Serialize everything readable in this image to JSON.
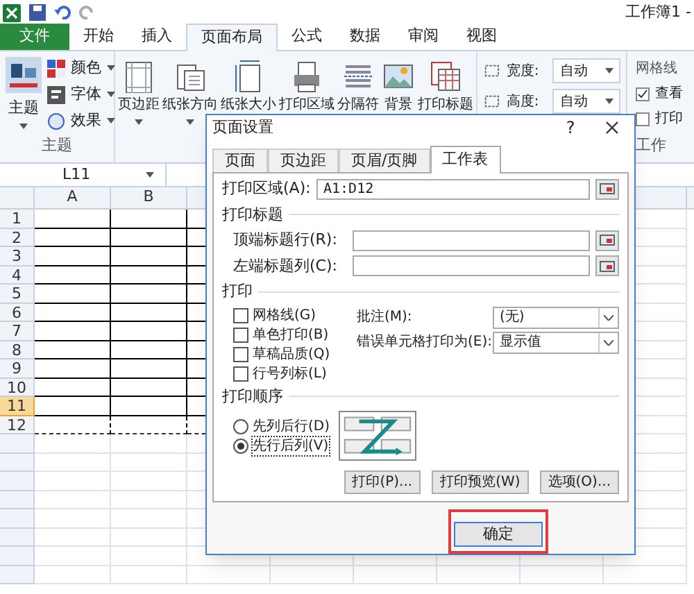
{
  "title_bar": {
    "title": "工作簿1 -"
  },
  "ribbon_tabs": [
    {
      "label": "文件",
      "kind": "file",
      "selected": false
    },
    {
      "label": "开始",
      "kind": "tab",
      "selected": false
    },
    {
      "label": "插入",
      "kind": "tab",
      "selected": false
    },
    {
      "label": "页面布局",
      "kind": "tab",
      "selected": true
    },
    {
      "label": "公式",
      "kind": "tab",
      "selected": false
    },
    {
      "label": "数据",
      "kind": "tab",
      "selected": false
    },
    {
      "label": "审阅",
      "kind": "tab",
      "selected": false
    },
    {
      "label": "视图",
      "kind": "tab",
      "selected": false
    }
  ],
  "theme_group": {
    "label": "主题",
    "main_button": "主题",
    "small_buttons": [
      "颜色",
      "字体",
      "效果"
    ]
  },
  "page_setup_buttons": [
    {
      "label": "页边距",
      "caret": true
    },
    {
      "label": "纸张方向",
      "caret": true
    },
    {
      "label": "纸张大小",
      "caret": false
    },
    {
      "label": "打印区域",
      "caret": false
    },
    {
      "label": "分隔符",
      "caret": false
    },
    {
      "label": "背景",
      "caret": false
    },
    {
      "label": "打印标题",
      "caret": false
    }
  ],
  "scale_group": [
    {
      "label": "宽度:",
      "value": "自动"
    },
    {
      "label": "高度:",
      "value": "自动"
    }
  ],
  "sheet_options": {
    "heading": "网格线",
    "items": [
      {
        "label": "查看",
        "checked": true
      },
      {
        "label": "打印",
        "checked": false
      }
    ],
    "group_label": "工作"
  },
  "name_box": "L11",
  "sheet": {
    "columns": [
      "A",
      "B"
    ],
    "rows": [
      {
        "label": "1",
        "selected": false
      },
      {
        "label": "2",
        "selected": false
      },
      {
        "label": "3",
        "selected": false
      },
      {
        "label": "4",
        "selected": false
      },
      {
        "label": "5",
        "selected": false
      },
      {
        "label": "6",
        "selected": false
      },
      {
        "label": "7",
        "selected": false
      },
      {
        "label": "8",
        "selected": false
      },
      {
        "label": "9",
        "selected": false
      },
      {
        "label": "10",
        "selected": false
      },
      {
        "label": "11",
        "selected": true
      },
      {
        "label": "12",
        "selected": false
      }
    ]
  },
  "dialog": {
    "title": "页面设置",
    "help": "?",
    "tabs": [
      {
        "label": "页面",
        "selected": false
      },
      {
        "label": "页边距",
        "selected": false
      },
      {
        "label": "页眉/页脚",
        "selected": false
      },
      {
        "label": "工作表",
        "selected": true
      }
    ],
    "print_area": {
      "label": "打印区域(A):",
      "value": "A1:D12"
    },
    "print_titles": {
      "heading": "打印标题",
      "fields": [
        {
          "label": "顶端标题行(R):"
        },
        {
          "label": "左端标题列(C):"
        }
      ]
    },
    "print": {
      "heading": "打印",
      "checkboxes": [
        {
          "label": "网格线(G)",
          "checked": false
        },
        {
          "label": "单色打印(B)",
          "checked": false
        },
        {
          "label": "草稿品质(Q)",
          "checked": false
        },
        {
          "label": "行号列标(L)",
          "checked": false
        }
      ],
      "selects": [
        {
          "label": "批注(M):",
          "value": "(无)"
        },
        {
          "label": "错误单元格打印为(E):",
          "value": "显示值"
        }
      ]
    },
    "page_order": {
      "heading": "打印顺序",
      "options": [
        {
          "label": "先列后行(D)",
          "selected": false
        },
        {
          "label": "先行后列(V)",
          "selected": true
        }
      ]
    },
    "buttons": [
      "打印(P)...",
      "打印预览(W)",
      "选项(O)..."
    ],
    "ok_button": {
      "label": "确定",
      "highlighted": true
    }
  }
}
